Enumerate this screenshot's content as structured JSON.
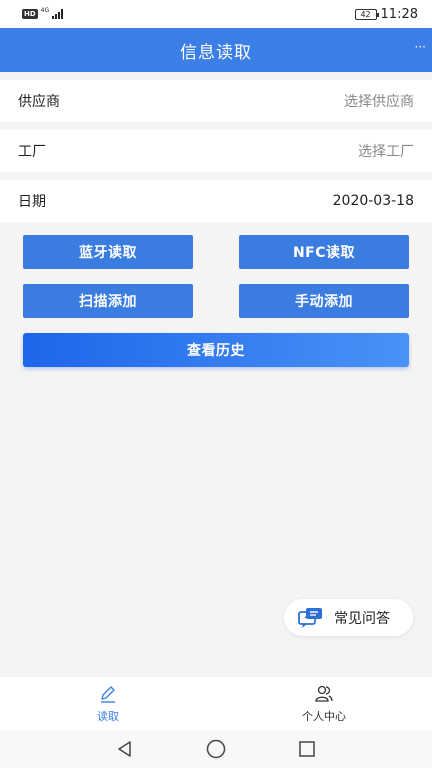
{
  "status_bar": {
    "hd": "HD",
    "network": "4G",
    "battery": "42",
    "time": "11:28"
  },
  "header": {
    "title": "信息读取",
    "more": "···"
  },
  "form": {
    "supplier_label": "供应商",
    "supplier_placeholder": "选择供应商",
    "factory_label": "工厂",
    "factory_placeholder": "选择工厂",
    "date_label": "日期",
    "date_value": "2020-03-18"
  },
  "actions": {
    "bluetooth_read": "蓝牙读取",
    "nfc_read": "NFC读取",
    "scan_add": "扫描添加",
    "manual_add": "手动添加",
    "view_history": "查看历史"
  },
  "faq": {
    "label": "常见问答"
  },
  "tabs": [
    {
      "label": "读取",
      "icon": "pencil-icon",
      "active": true
    },
    {
      "label": "个人中心",
      "icon": "users-icon",
      "active": false
    }
  ],
  "colors": {
    "primary": "#3b7fe6",
    "button": "#3a7ce0",
    "background": "#f4f4f4"
  }
}
